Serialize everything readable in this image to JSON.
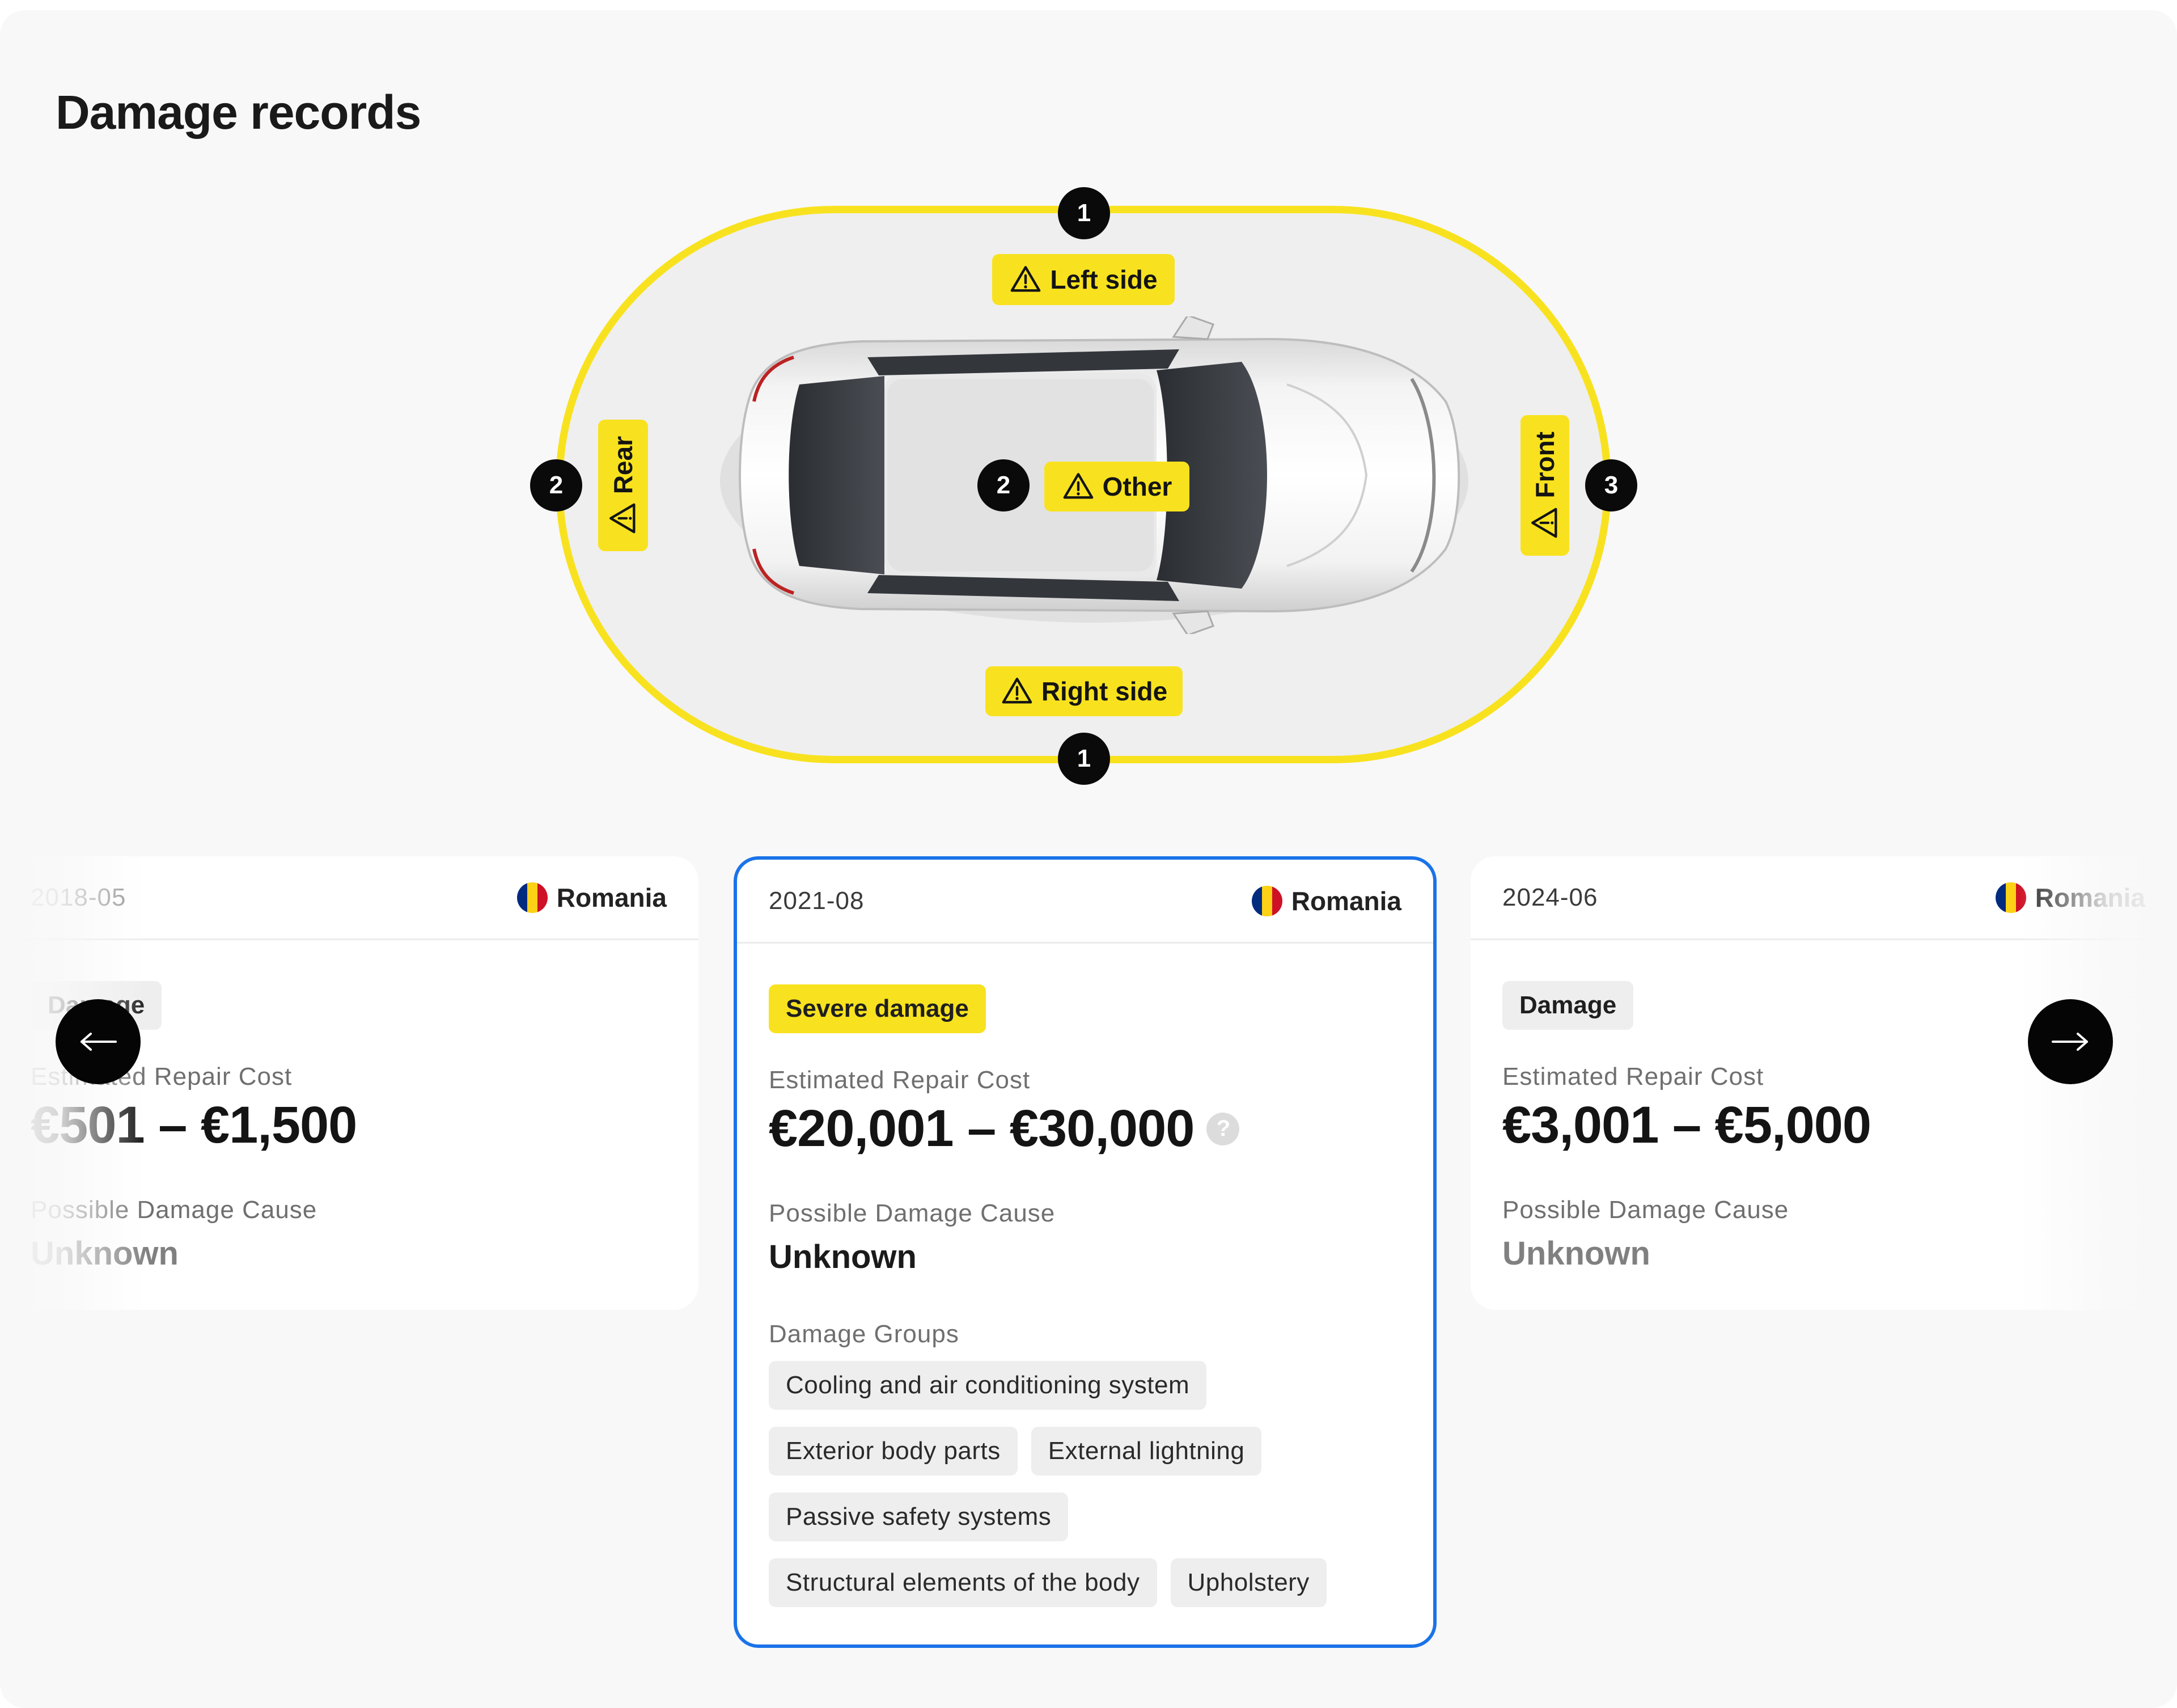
{
  "title": "Damage records",
  "diagram": {
    "zones": {
      "left_side": {
        "label": "Left side",
        "count": "1"
      },
      "right_side": {
        "label": "Right side",
        "count": "1"
      },
      "rear": {
        "label": "Rear",
        "count": "2"
      },
      "front": {
        "label": "Front",
        "count": "3"
      },
      "other": {
        "label": "Other",
        "count": "2"
      }
    },
    "accent_color": "#f8e21f"
  },
  "records": [
    {
      "date": "2018-05",
      "country": "Romania",
      "severity": "Damage",
      "cost_label": "Estimated Repair Cost",
      "cost": "€501 – €1,500",
      "cause_label": "Possible Damage Cause",
      "cause": "Unknown"
    },
    {
      "date": "2021-08",
      "country": "Romania",
      "severity": "Severe damage",
      "cost_label": "Estimated Repair Cost",
      "cost": "€20,001 – €30,000",
      "cause_label": "Possible Damage Cause",
      "cause": "Unknown",
      "groups_label": "Damage Groups",
      "groups": [
        "Cooling and air conditioning system",
        "Exterior body parts",
        "External lightning",
        "Passive safety systems",
        "Structural elements of the body",
        "Upholstery"
      ],
      "help": "?"
    },
    {
      "date": "2024-06",
      "country": "Romania",
      "severity": "Damage",
      "cost_label": "Estimated Repair Cost",
      "cost": "€3,001 – €5,000",
      "cause_label": "Possible Damage Cause",
      "cause": "Unknown"
    }
  ],
  "nav": {
    "prev_icon": "arrow-left-icon",
    "next_icon": "arrow-right-icon"
  },
  "colors": {
    "selected_border": "#1a73e8",
    "flag": [
      "#002b7f",
      "#fcd116",
      "#ce1126"
    ]
  }
}
